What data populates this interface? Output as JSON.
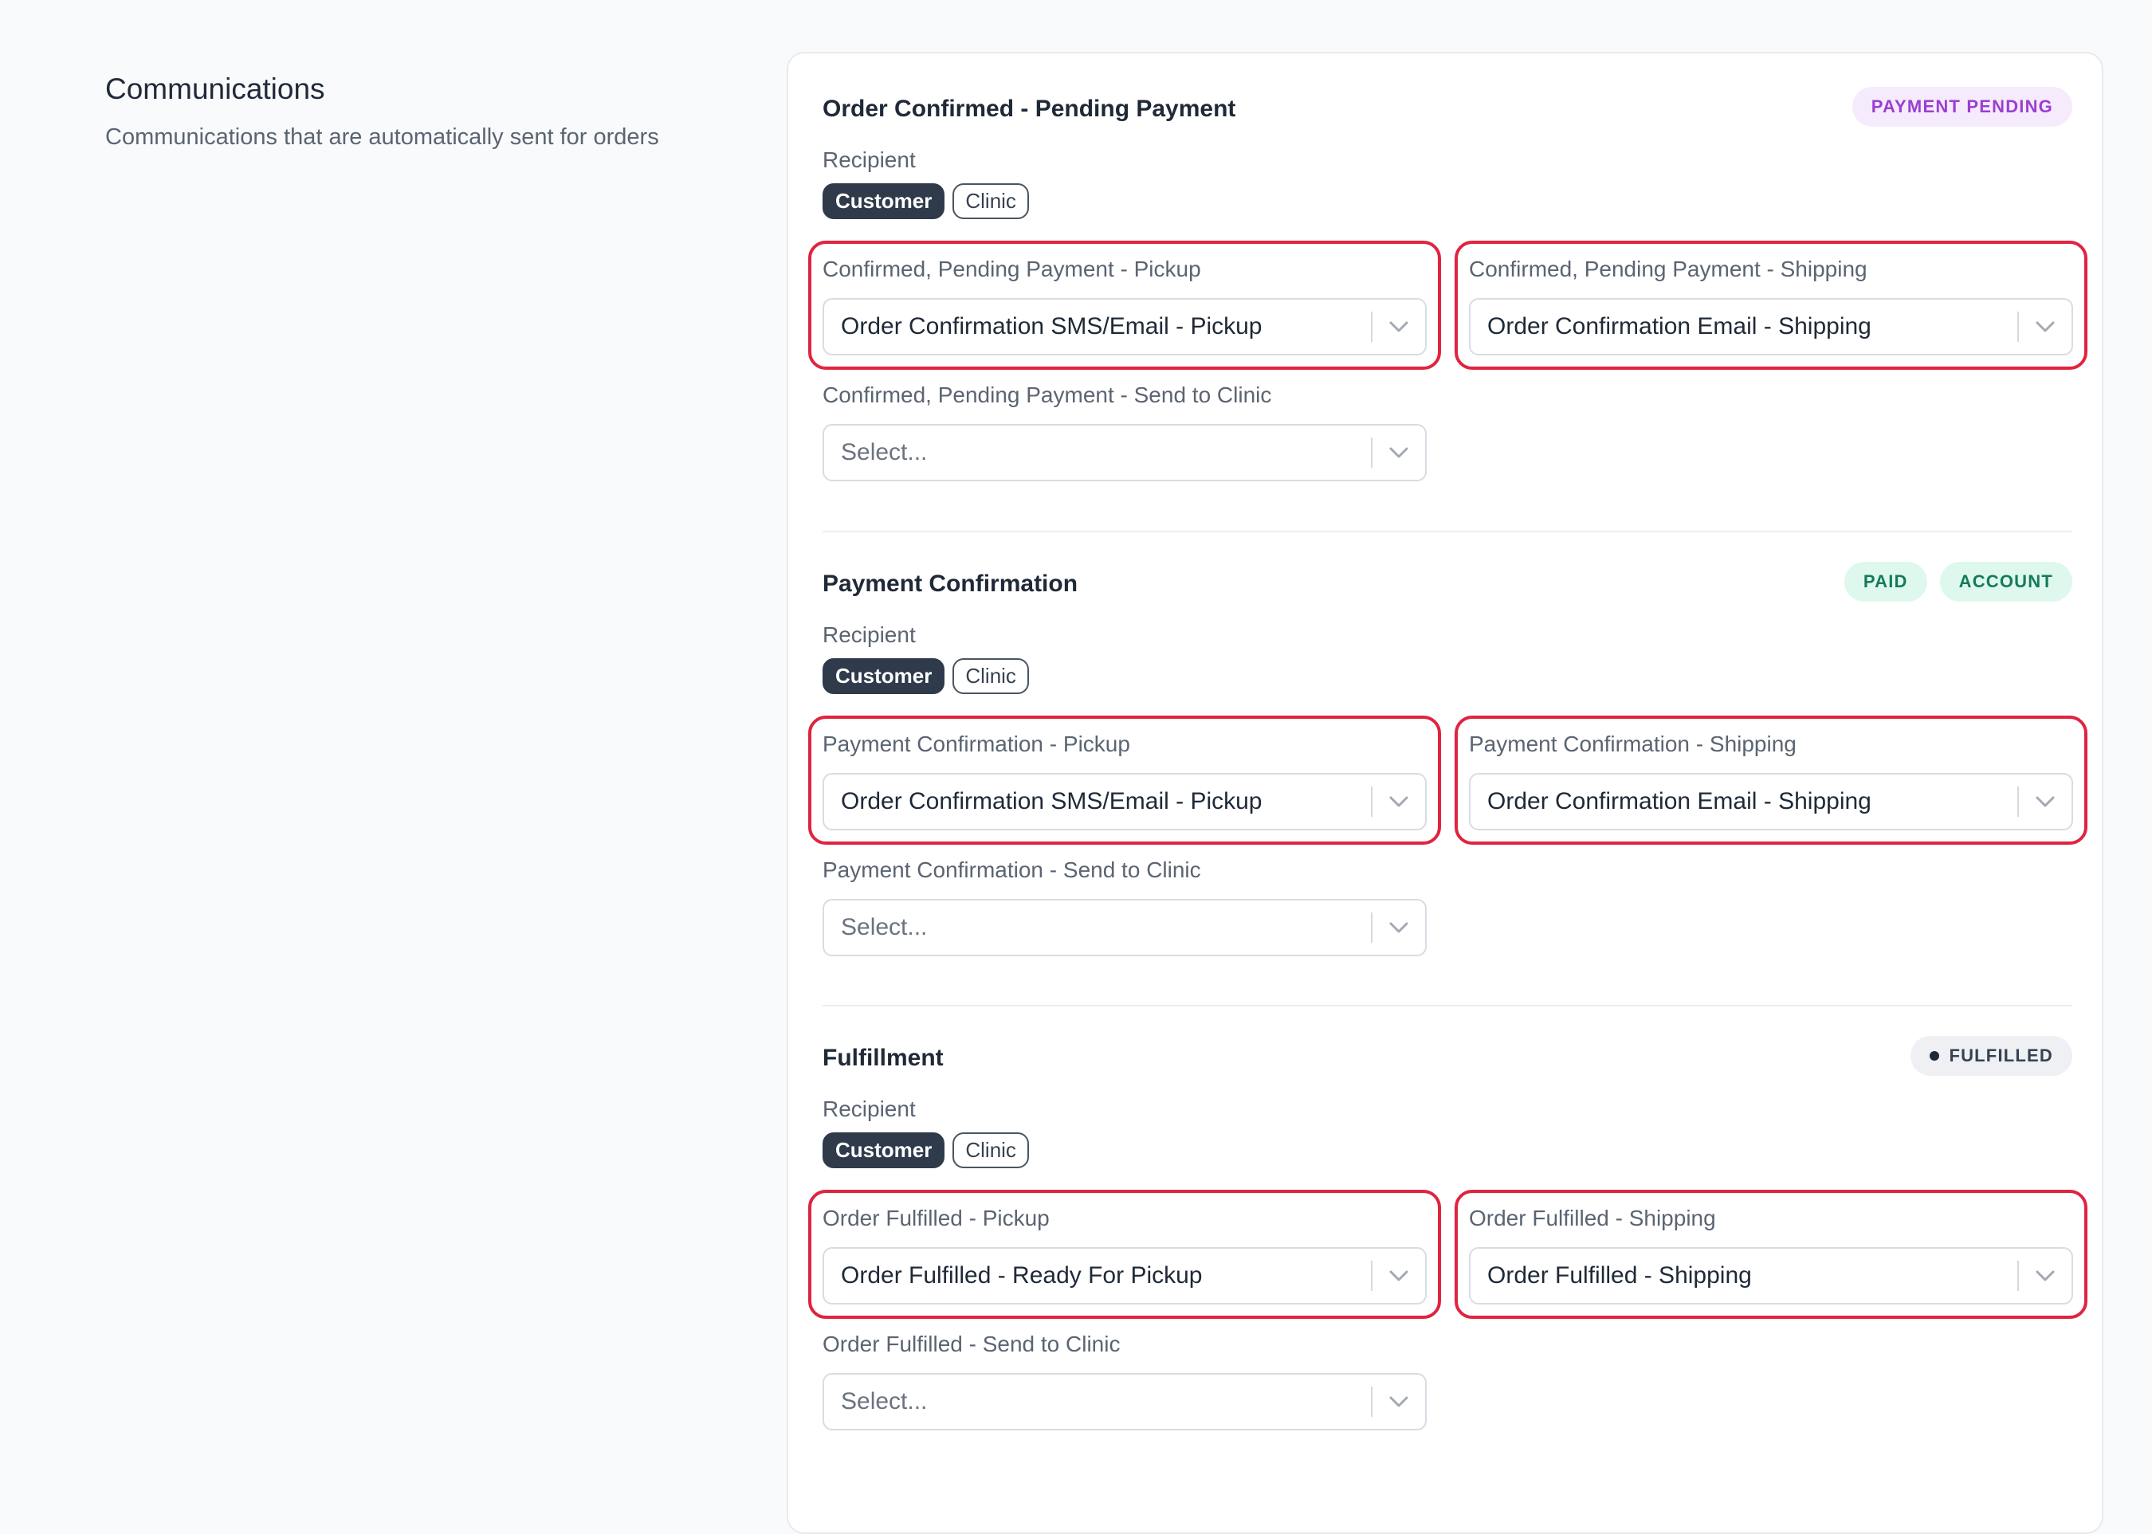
{
  "page": {
    "title": "Communications",
    "description": "Communications that are automatically sent for orders"
  },
  "sections": [
    {
      "title": "Order Confirmed - Pending Payment",
      "badges": [
        "PAYMENT PENDING"
      ],
      "recipient_label": "Recipient",
      "recipients": [
        {
          "label": "Customer",
          "selected": true
        },
        {
          "label": "Clinic",
          "selected": false
        }
      ],
      "fields": [
        {
          "label": "Confirmed, Pending Payment - Pickup",
          "value": "Order Confirmation SMS/Email - Pickup",
          "placeholder": "",
          "highlighted": true
        },
        {
          "label": "Confirmed, Pending Payment - Shipping",
          "value": "Order Confirmation Email - Shipping",
          "placeholder": "",
          "highlighted": true
        },
        {
          "label": "Confirmed, Pending Payment - Send to Clinic",
          "value": "",
          "placeholder": "Select...",
          "highlighted": false
        }
      ]
    },
    {
      "title": "Payment Confirmation",
      "badges": [
        "PAID",
        "ACCOUNT"
      ],
      "recipient_label": "Recipient",
      "recipients": [
        {
          "label": "Customer",
          "selected": true
        },
        {
          "label": "Clinic",
          "selected": false
        }
      ],
      "fields": [
        {
          "label": "Payment Confirmation - Pickup",
          "value": "Order Confirmation SMS/Email - Pickup",
          "placeholder": "",
          "highlighted": true
        },
        {
          "label": "Payment Confirmation - Shipping",
          "value": "Order Confirmation Email - Shipping",
          "placeholder": "",
          "highlighted": true
        },
        {
          "label": "Payment Confirmation - Send to Clinic",
          "value": "",
          "placeholder": "Select...",
          "highlighted": false
        }
      ]
    },
    {
      "title": "Fulfillment",
      "badges": [
        "FULFILLED"
      ],
      "recipient_label": "Recipient",
      "recipients": [
        {
          "label": "Customer",
          "selected": true
        },
        {
          "label": "Clinic",
          "selected": false
        }
      ],
      "fields": [
        {
          "label": "Order Fulfilled - Pickup",
          "value": "Order Fulfilled - Ready For Pickup",
          "placeholder": "",
          "highlighted": true
        },
        {
          "label": "Order Fulfilled - Shipping",
          "value": "Order Fulfilled - Shipping",
          "placeholder": "",
          "highlighted": true
        },
        {
          "label": "Order Fulfilled - Send to Clinic",
          "value": "",
          "placeholder": "Select...",
          "highlighted": false
        }
      ]
    }
  ],
  "colors": {
    "highlight": "#e0243f",
    "chip_active": "#2f3a4b",
    "badge_purple_text": "#9b3fd0",
    "badge_green_text": "#147a5b"
  },
  "icons": {
    "dropdown": "chevron-down-icon",
    "status_dot": "dot-icon"
  }
}
